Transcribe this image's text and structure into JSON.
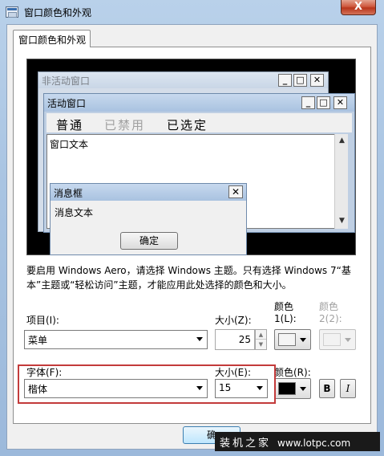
{
  "window": {
    "title": "窗口颜色和外观",
    "close_glyph": "X"
  },
  "tabs": [
    {
      "label": "窗口颜色和外观"
    }
  ],
  "preview": {
    "inactive_title": "非活动窗口",
    "active_title": "活动窗口",
    "menu": {
      "normal": "普通",
      "disabled": "已禁用",
      "selected": "已选定"
    },
    "window_text": "窗口文本",
    "message_box": {
      "title": "消息框",
      "text": "消息文本",
      "ok": "确定"
    },
    "caption_glyphs": {
      "minimize": "_",
      "maximize": "□",
      "close": "✕"
    }
  },
  "info_text": "要启用 Windows Aero，请选择 Windows 主题。只有选择 Windows 7“基本”主题或“轻松访问”主题，才能应用此处选择的颜色和大小。",
  "item": {
    "label": "项目(I):",
    "value": "菜单"
  },
  "item_size": {
    "label": "大小(Z):",
    "value": "25"
  },
  "color1": {
    "label_line1": "颜色",
    "label_line2": "1(L):",
    "color": "#f4f4f4"
  },
  "color2": {
    "label_line1": "颜色",
    "label_line2": "2(2):",
    "color": "#f2f2f2"
  },
  "font": {
    "label": "字体(F):",
    "value": "楷体"
  },
  "font_size": {
    "label": "大小(E):",
    "value": "15"
  },
  "font_color": {
    "label": "颜色(R):",
    "color": "#000000"
  },
  "style_buttons": {
    "bold": "B",
    "italic": "I"
  },
  "bottom": {
    "ok": "确"
  },
  "watermark": {
    "brand": "装机之家",
    "url": "www.lotpc.com"
  },
  "highlight_color": "#c33b3b"
}
